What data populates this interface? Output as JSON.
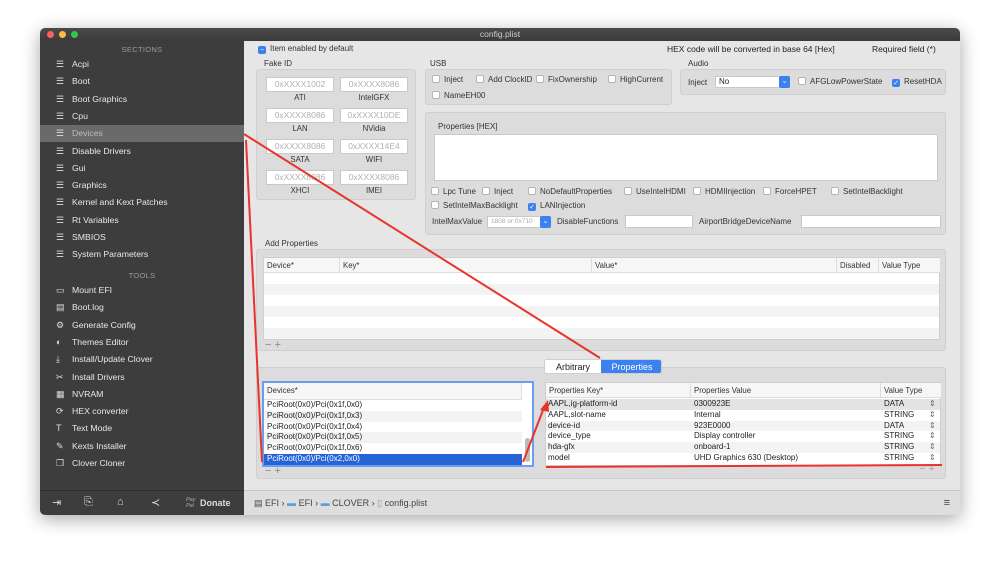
{
  "window": {
    "title": "config.plist"
  },
  "sidebar": {
    "sections_header": "SECTIONS",
    "sections": [
      {
        "label": "Acpi"
      },
      {
        "label": "Boot"
      },
      {
        "label": "Boot Graphics"
      },
      {
        "label": "Cpu"
      },
      {
        "label": "Devices",
        "selected": true
      },
      {
        "label": "Disable Drivers"
      },
      {
        "label": "Gui"
      },
      {
        "label": "Graphics"
      },
      {
        "label": "Kernel and Kext Patches"
      },
      {
        "label": "Rt Variables"
      },
      {
        "label": "SMBIOS"
      },
      {
        "label": "System Parameters"
      }
    ],
    "tools_header": "TOOLS",
    "tools": [
      {
        "label": "Mount EFI",
        "icon": "disk-icon"
      },
      {
        "label": "Boot.log",
        "icon": "document-icon"
      },
      {
        "label": "Generate Config",
        "icon": "gears-icon"
      },
      {
        "label": "Themes Editor",
        "icon": "palette-icon"
      },
      {
        "label": "Install/Update Clover",
        "icon": "download-icon"
      },
      {
        "label": "Install Drivers",
        "icon": "tools-icon"
      },
      {
        "label": "NVRAM",
        "icon": "chip-icon"
      },
      {
        "label": "HEX converter",
        "icon": "refresh-icon"
      },
      {
        "label": "Text Mode",
        "icon": "text-icon"
      },
      {
        "label": "Kexts Installer",
        "icon": "wrench-icon"
      },
      {
        "label": "Clover Cloner",
        "icon": "clone-icon"
      }
    ],
    "bottom": {
      "paypal": "Pay Pal",
      "donate": "Donate"
    }
  },
  "header": {
    "enabled_label": "Item enabled by default",
    "hex_note": "HEX code will be converted in base 64 [Hex]",
    "required_note": "Required field (*)"
  },
  "fake_id": {
    "title": "Fake ID",
    "fields": [
      {
        "label": "ATI",
        "placeholder": "0xXXXX1002"
      },
      {
        "label": "IntelGFX",
        "placeholder": "0xXXXX8086"
      },
      {
        "label": "LAN",
        "placeholder": "0xXXXX8086"
      },
      {
        "label": "NVidia",
        "placeholder": "0xXXXX10DE"
      },
      {
        "label": "SATA",
        "placeholder": "0xXXXX8086"
      },
      {
        "label": "WIFI",
        "placeholder": "0xXXXX14E4"
      },
      {
        "label": "XHCI",
        "placeholder": "0xXXXX8086"
      },
      {
        "label": "IMEI",
        "placeholder": "0xXXXX8086"
      }
    ]
  },
  "usb": {
    "title": "USB",
    "options": [
      {
        "label": "Inject",
        "checked": false
      },
      {
        "label": "Add ClockID",
        "checked": false
      },
      {
        "label": "FixOwnership",
        "checked": false
      },
      {
        "label": "HighCurrent",
        "checked": false
      },
      {
        "label": "NameEH00",
        "checked": false
      }
    ]
  },
  "audio": {
    "title": "Audio",
    "inject_label": "Inject",
    "inject_value": "No",
    "options": [
      {
        "label": "AFGLowPowerState",
        "checked": false
      },
      {
        "label": "ResetHDA",
        "checked": true
      }
    ]
  },
  "properties": {
    "title": "Properties [HEX]",
    "value": "",
    "options": [
      {
        "label": "Lpc Tune",
        "checked": false
      },
      {
        "label": "Inject",
        "checked": false
      },
      {
        "label": "NoDefaultProperties",
        "checked": false
      },
      {
        "label": "UseIntelHDMI",
        "checked": false
      },
      {
        "label": "HDMIInjection",
        "checked": false
      },
      {
        "label": "ForceHPET",
        "checked": false
      },
      {
        "label": "SetIntelBacklight",
        "checked": false
      },
      {
        "label": "SetIntelMaxBacklight",
        "checked": false
      },
      {
        "label": "LANInjection",
        "checked": true
      }
    ],
    "intel_max_label": "IntelMaxValue",
    "intel_max_placeholder": "1808 or 0x710",
    "disable_functions_label": "DisableFunctions",
    "airport_label": "AirportBridgeDeviceName"
  },
  "add_properties": {
    "title": "Add Properties",
    "columns": [
      "Device*",
      "Key*",
      "Value*",
      "Disabled",
      "Value Type"
    ],
    "rows": []
  },
  "tabs": [
    {
      "label": "Arbitrary",
      "active": false
    },
    {
      "label": "Properties",
      "active": true
    }
  ],
  "devices": {
    "header": "Devices*",
    "items": [
      "PciRoot(0x0)/Pci(0x1f,0x0)",
      "PciRoot(0x0)/Pci(0x1f,0x3)",
      "PciRoot(0x0)/Pci(0x1f,0x4)",
      "PciRoot(0x0)/Pci(0x1f,0x5)",
      "PciRoot(0x0)/Pci(0x1f,0x6)",
      "PciRoot(0x0)/Pci(0x2,0x0)"
    ],
    "selected": 5
  },
  "prop_table": {
    "columns": [
      "Properties Key*",
      "Properties Value",
      "Value Type"
    ],
    "rows": [
      {
        "key": "AAPL,ig-platform-id",
        "value": "0300923E",
        "type": "DATA"
      },
      {
        "key": "AAPL,slot-name",
        "value": "Internal",
        "type": "STRING"
      },
      {
        "key": "device-id",
        "value": "923E0000",
        "type": "DATA"
      },
      {
        "key": "device_type",
        "value": "Display controller",
        "type": "STRING"
      },
      {
        "key": "hda-gfx",
        "value": "onboard-1",
        "type": "STRING"
      },
      {
        "key": "model",
        "value": "UHD Graphics 630 (Desktop)",
        "type": "STRING"
      }
    ]
  },
  "footer": {
    "breadcrumb": [
      "EFI",
      "EFI",
      "CLOVER",
      "config.plist"
    ]
  },
  "colors": {
    "accent": "#3b82f0",
    "annotation": "#e8342c",
    "sidebar": "#3d3d3d"
  }
}
